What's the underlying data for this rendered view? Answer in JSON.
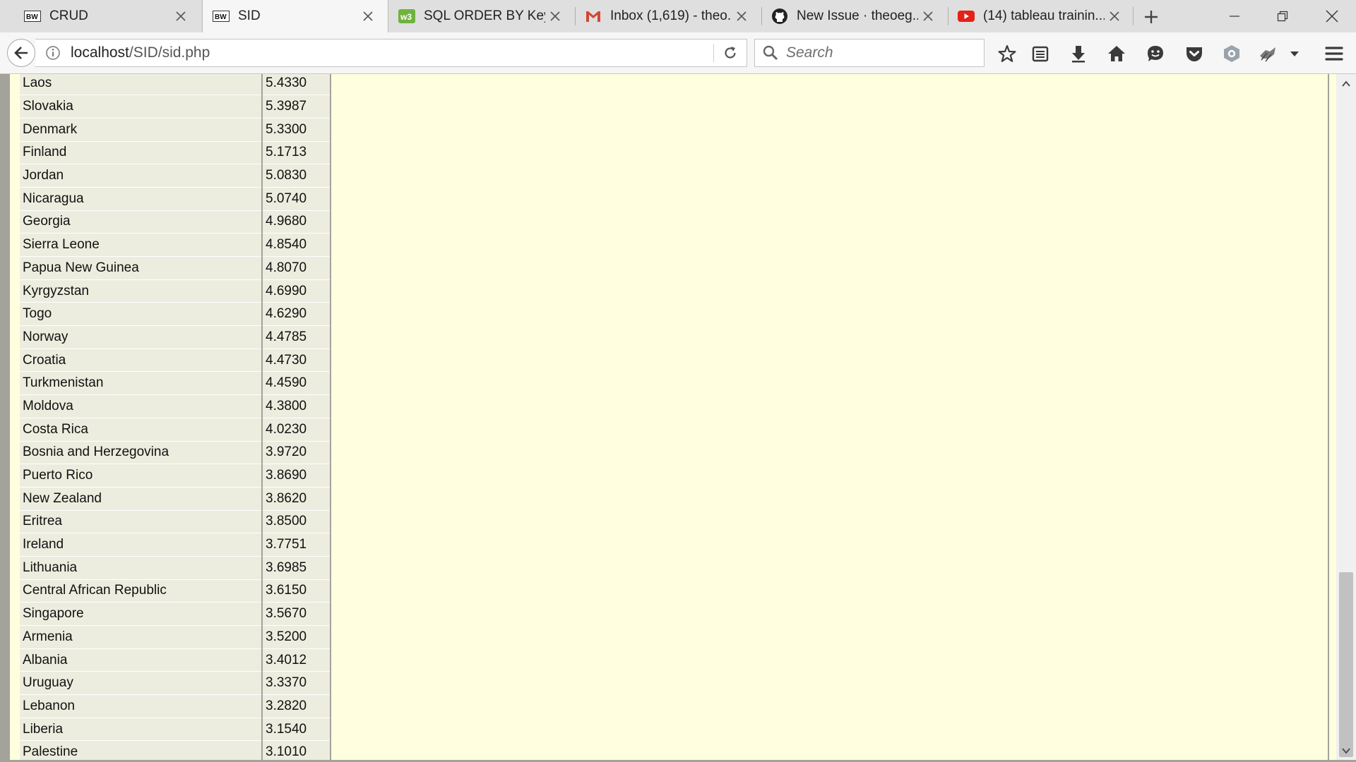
{
  "tabs": [
    {
      "title": "CRUD",
      "icon": "bw-favicon-icon",
      "active": false
    },
    {
      "title": "SID",
      "icon": "bw-favicon-icon",
      "active": true
    },
    {
      "title": "SQL ORDER BY Key...",
      "icon": "w3schools-icon",
      "active": false
    },
    {
      "title": "Inbox (1,619) - theo...",
      "icon": "gmail-icon",
      "active": false
    },
    {
      "title": "New Issue · theoeg...",
      "icon": "github-icon",
      "active": false
    },
    {
      "title": "(14) tableau trainin...",
      "icon": "youtube-icon",
      "active": false
    }
  ],
  "address": {
    "host": "localhost",
    "path": "/SID/sid.php"
  },
  "search": {
    "placeholder": "Search"
  },
  "toolbar_icons": [
    "bookmark-star-icon",
    "reading-list-icon",
    "download-icon",
    "home-icon",
    "emoji-icon",
    "pocket-icon",
    "extension-icon",
    "addon-icon",
    "menu-icon"
  ],
  "colors": {
    "page_bg": "#ffffdf",
    "cell_bg": "#ededdf",
    "border": "#a3a39b",
    "gmail": "#d44638",
    "youtube": "#e62117",
    "w3": "#6fb33f"
  },
  "rows": [
    {
      "country": "Laos",
      "value": "5.4330"
    },
    {
      "country": "Slovakia",
      "value": "5.3987"
    },
    {
      "country": "Denmark",
      "value": "5.3300"
    },
    {
      "country": "Finland",
      "value": "5.1713"
    },
    {
      "country": "Jordan",
      "value": "5.0830"
    },
    {
      "country": "Nicaragua",
      "value": "5.0740"
    },
    {
      "country": "Georgia",
      "value": "4.9680"
    },
    {
      "country": "Sierra Leone",
      "value": "4.8540"
    },
    {
      "country": "Papua New Guinea",
      "value": "4.8070"
    },
    {
      "country": "Kyrgyzstan",
      "value": "4.6990"
    },
    {
      "country": "Togo",
      "value": "4.6290"
    },
    {
      "country": "Norway",
      "value": "4.4785"
    },
    {
      "country": "Croatia",
      "value": "4.4730"
    },
    {
      "country": "Turkmenistan",
      "value": "4.4590"
    },
    {
      "country": "Moldova",
      "value": "4.3800"
    },
    {
      "country": "Costa Rica",
      "value": "4.0230"
    },
    {
      "country": "Bosnia and Herzegovina",
      "value": "3.9720"
    },
    {
      "country": "Puerto Rico",
      "value": "3.8690"
    },
    {
      "country": "New Zealand",
      "value": "3.8620"
    },
    {
      "country": "Eritrea",
      "value": "3.8500"
    },
    {
      "country": "Ireland",
      "value": "3.7751"
    },
    {
      "country": "Lithuania",
      "value": "3.6985"
    },
    {
      "country": "Central African Republic",
      "value": "3.6150"
    },
    {
      "country": "Singapore",
      "value": "3.5670"
    },
    {
      "country": "Armenia",
      "value": "3.5200"
    },
    {
      "country": "Albania",
      "value": "3.4012"
    },
    {
      "country": "Uruguay",
      "value": "3.3370"
    },
    {
      "country": "Lebanon",
      "value": "3.2820"
    },
    {
      "country": "Liberia",
      "value": "3.1540"
    },
    {
      "country": "Palestine",
      "value": "3.1010"
    }
  ]
}
